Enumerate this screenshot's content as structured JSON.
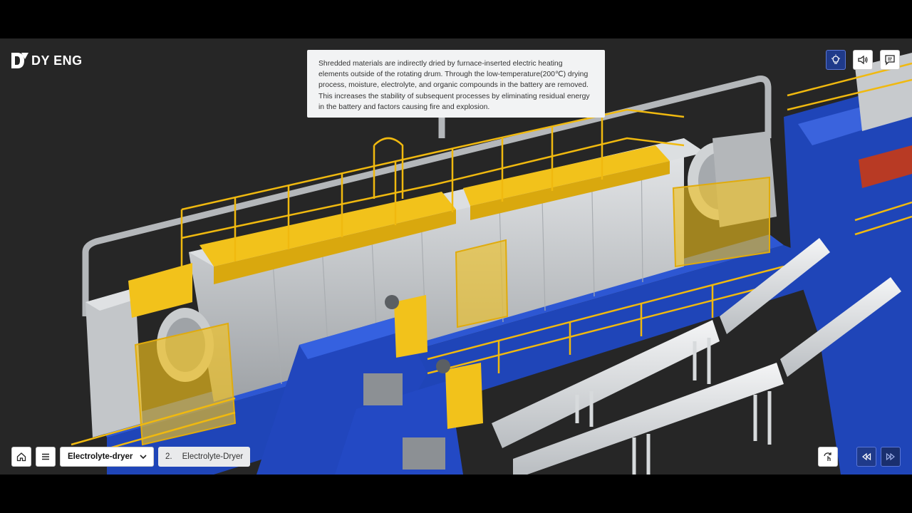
{
  "brand": {
    "name": "DY ENG"
  },
  "info": {
    "text": "Shredded materials are indirectly dried by furnace-inserted electric heating elements outside of the rotating drum. Through the low-temperature(200℃) drying process, moisture, electrolyte, and organic compounds in the battery are removed. This increases the stability of subsequent processes by eliminating residual energy in the battery and factors causing fire and explosion."
  },
  "toolbar": {
    "icons": [
      "lightbulb-icon",
      "speaker-icon",
      "chat-icon"
    ]
  },
  "navigation": {
    "process_select": {
      "value": "Electrolyte-dryer"
    },
    "step": {
      "number": "2.",
      "label": "Electrolyte-Dryer"
    }
  },
  "colors": {
    "background": "#262626",
    "frame": "#000000",
    "steel_blue": "#1f45b8",
    "safety_yellow": "#f2c21b",
    "drum_grey": "#cfd2d4",
    "active_button": "#1f3a8a"
  }
}
